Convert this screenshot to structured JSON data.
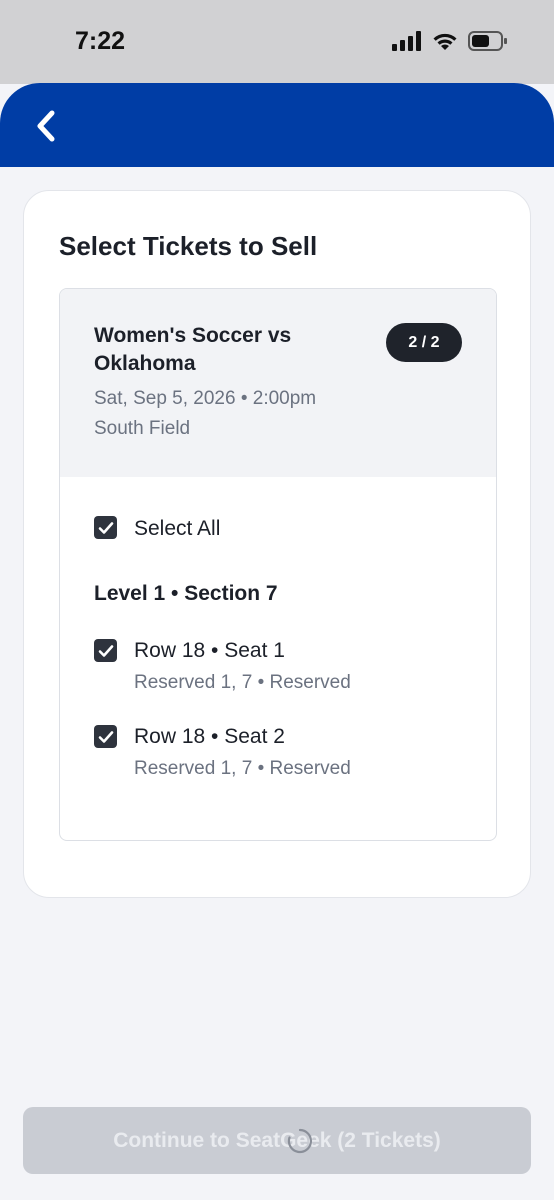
{
  "status_bar": {
    "time": "7:22",
    "icons": [
      "signal-icon",
      "wifi-icon",
      "battery-icon"
    ]
  },
  "header": {
    "back_icon": "chevron-left-icon",
    "color": "#003da5"
  },
  "card": {
    "title": "Select Tickets to Sell"
  },
  "event": {
    "name": "Women's Soccer vs Oklahoma",
    "badge": "2 / 2",
    "date_time": "Sat, Sep 5, 2026 • 2:00pm",
    "venue": "South Field"
  },
  "select_all": {
    "label": "Select All",
    "checked": true
  },
  "section": {
    "heading": "Level 1 • Section 7",
    "seats": [
      {
        "label": "Row 18 • Seat 1",
        "sub": "Reserved 1, 7 • Reserved",
        "checked": true
      },
      {
        "label": "Row 18 • Seat 2",
        "sub": "Reserved 1, 7 • Reserved",
        "checked": true
      }
    ]
  },
  "footer": {
    "continue_label": "Continue to SeatGeek (2 Tickets)",
    "loading_icon": "spinner-icon"
  }
}
